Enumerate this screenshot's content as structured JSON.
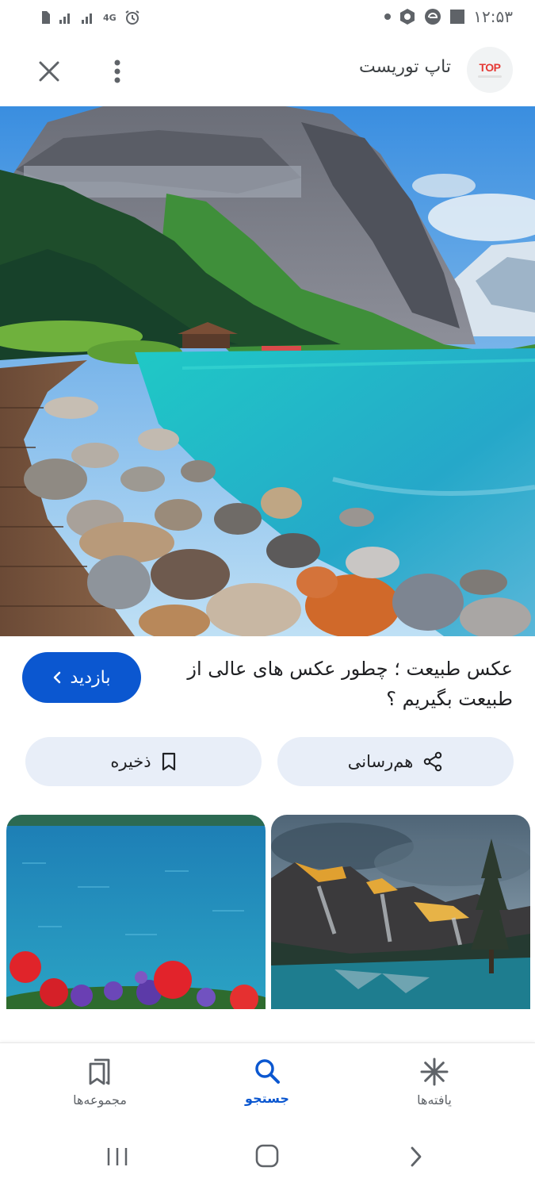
{
  "status_bar": {
    "time": "۱۲:۵۳",
    "network": "4G"
  },
  "header": {
    "site_name": "تاپ توریست",
    "logo_text": "TOP"
  },
  "result": {
    "title": "عکس طبیعت ؛ چطور عکس های عالی از طبیعت بگیریم ؟",
    "visit_label": "بازدید"
  },
  "actions": {
    "share_label": "هم‌رسانی",
    "save_label": "ذخیره"
  },
  "bottom_nav": {
    "items": [
      {
        "label": "یافته‌ها",
        "icon": "asterisk-icon"
      },
      {
        "label": "جستجو",
        "icon": "search-icon",
        "active": true
      },
      {
        "label": "مجموعه‌ها",
        "icon": "collections-icon"
      }
    ]
  },
  "colors": {
    "accent": "#0b57d0",
    "chip_bg": "#e8eef8"
  }
}
